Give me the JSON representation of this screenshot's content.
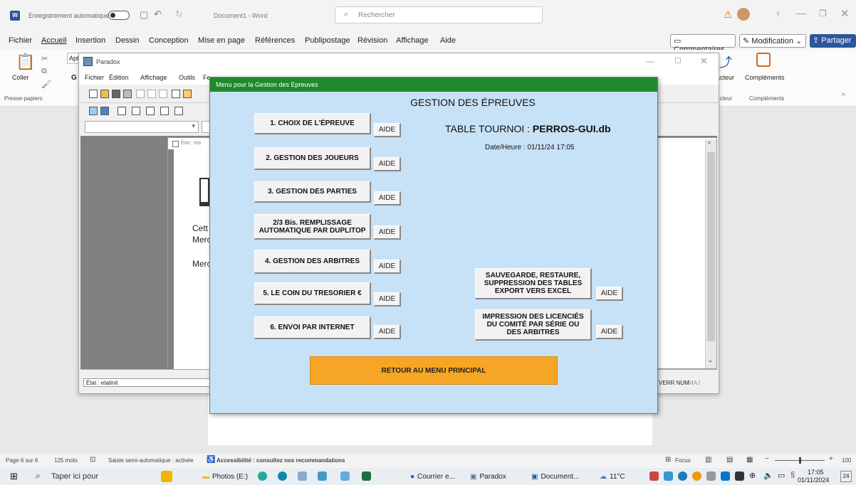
{
  "word": {
    "autosave_label": "Enregistrement automatique",
    "doc_title": "Document1  -  Word",
    "search_placeholder": "Rechercher",
    "menu": [
      "Fichier",
      "Accueil",
      "Insertion",
      "Dessin",
      "Conception",
      "Mise en page",
      "Références",
      "Publipostage",
      "Révision",
      "Affichage",
      "Aide"
    ],
    "comments_label": "Commentaires",
    "modification_label": "Modification",
    "share_label": "Partager",
    "paste_label": "Coller",
    "clipboard_label": "Presse-papiers",
    "font_name_partial": "Apt",
    "dictate_label": "acteur",
    "complements_label": "Compléments",
    "complements_group": "Compléments",
    "doc_text_1": "Cett",
    "doc_text_2": "Merc",
    "doc_text_3": "Merc",
    "status_page": "Page 6 sur 6",
    "status_words": "125 mots",
    "status_mode": "Saisie semi-automatique : activée",
    "status_access": "Accessibilité : consultez nos recommandations",
    "status_focus": "Focus",
    "status_zoom": "100"
  },
  "paradox": {
    "title": "Paradox",
    "menu": [
      "Fichier",
      "Édition",
      "Affichage",
      "Outils",
      "Fe"
    ],
    "report_label": "État : eta",
    "status_left": "État : etatinit",
    "status_right": "VERR NUM",
    "status_maj": "MAJ"
  },
  "dialog": {
    "title": "Menu pour la Gestion des Epreuves",
    "heading": "GESTION DES ÉPREUVES",
    "table_label": "TABLE TOURNOI : ",
    "table_name": "PERROS-GUI.db",
    "datetime": "Date/Heure : 01/11/24 17:05",
    "buttons": [
      "1. CHOIX DE L'ÉPREUVE",
      "2. GESTION DES JOUEURS",
      "3. GESTION DES PARTIES",
      "2/3 Bis. REMPLISSAGE AUTOMATIQUE PAR DUPLITOP",
      "4. GESTION DES ARBITRES",
      "5. LE COIN DU TRESORIER  €",
      "6. ENVOI PAR INTERNET"
    ],
    "right_buttons": [
      "SAUVEGARDE, RESTAURE, SUPPRESSION DES TABLES EXPORT VERS EXCEL",
      "IMPRESSION DES LICENCIÉS DU COMITÉ PAR SÉRIE OU DES ARBITRES"
    ],
    "aide_label": "AIDE",
    "retour_label": "RETOUR AU MENU PRINCIPAL"
  },
  "taskbar": {
    "search_placeholder": "Taper ici pour",
    "apps": [
      "Photos (E:)",
      "Courrier e...",
      "Paradox",
      "Document..."
    ],
    "temperature": "11°C",
    "time": "17:05",
    "date": "01/11/2024",
    "notif_count": "24"
  }
}
